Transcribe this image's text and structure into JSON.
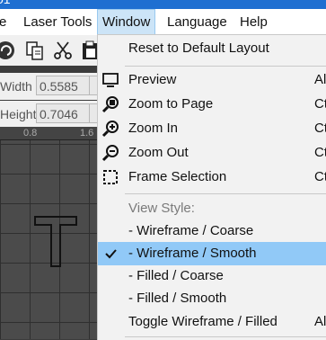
{
  "titlebar": {
    "text": "01"
  },
  "menubar": {
    "items": [
      {
        "label": "e"
      },
      {
        "label": "Laser Tools"
      },
      {
        "label": "Window"
      },
      {
        "label": "Language"
      },
      {
        "label": "Help"
      }
    ]
  },
  "fields": {
    "width_label": "Width",
    "width_value": "0.5585",
    "height_label": "Height",
    "height_value": "0.7046"
  },
  "ruler": {
    "ticks": [
      "0.8",
      "1.6"
    ]
  },
  "canvas": {
    "glyph": "T"
  },
  "window_menu": {
    "items": [
      {
        "label": "Reset to Default Layout",
        "shortcut": ""
      },
      {
        "label": "Preview",
        "shortcut": "Al"
      },
      {
        "label": "Zoom to Page",
        "shortcut": "Ct"
      },
      {
        "label": "Zoom In",
        "shortcut": "Ct"
      },
      {
        "label": "Zoom Out",
        "shortcut": "Ct"
      },
      {
        "label": "Frame Selection",
        "shortcut": "Ct"
      },
      {
        "label": "View Style:",
        "shortcut": ""
      },
      {
        "label": "-  Wireframe / Coarse",
        "shortcut": ""
      },
      {
        "label": "-  Wireframe / Smooth",
        "shortcut": ""
      },
      {
        "label": "-  Filled / Coarse",
        "shortcut": ""
      },
      {
        "label": "-  Filled / Smooth",
        "shortcut": ""
      },
      {
        "label": "Toggle Wireframe / Filled",
        "shortcut": "Al"
      }
    ],
    "checked_item": "-  Wireframe / Smooth"
  },
  "colors": {
    "menu_highlight": "#cce4f7",
    "checked_row": "#91c9f7",
    "titlebar": "#1e6fd1"
  }
}
